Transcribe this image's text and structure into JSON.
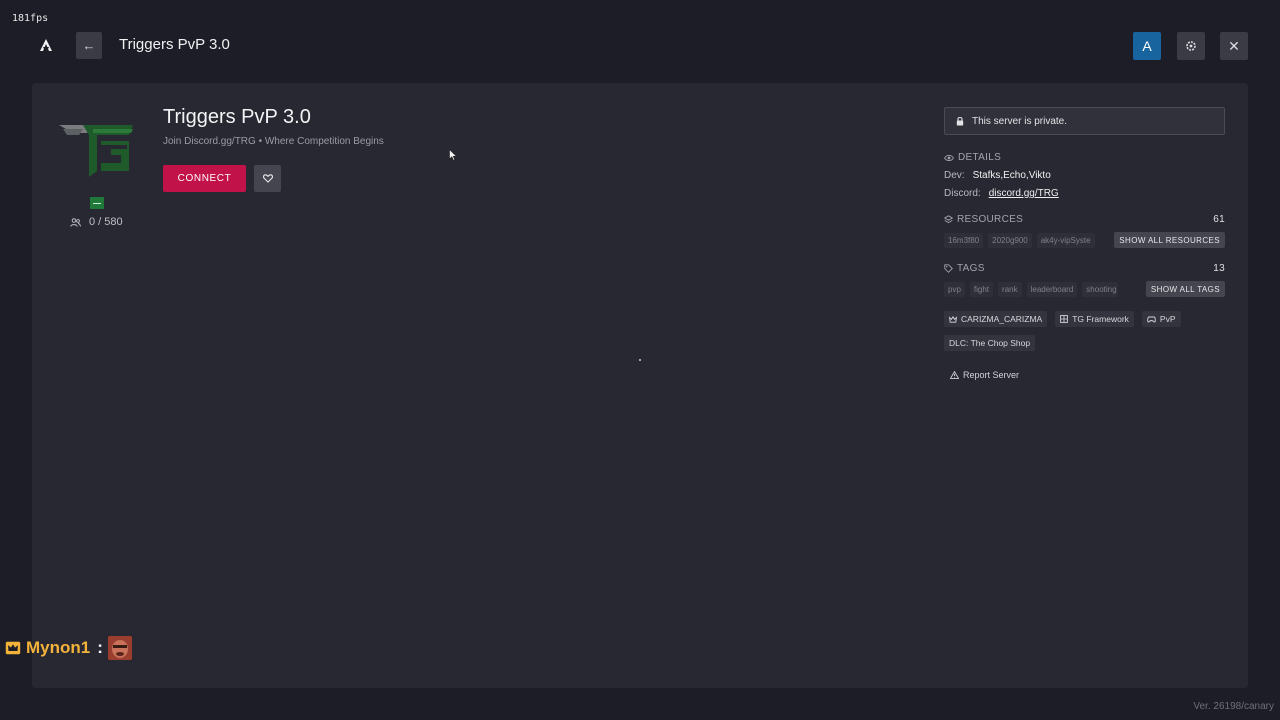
{
  "fps": "181fps",
  "header": {
    "title": "Triggers PvP 3.0",
    "account_initial": "A",
    "back_label": "←",
    "close_label": "✕"
  },
  "server": {
    "name": "Triggers PvP 3.0",
    "description": "Join Discord.gg/TRG • Where Competition Begins",
    "players": "0 / 580",
    "connect_label": "CONNECT"
  },
  "sidebar": {
    "private_notice": "This server is private.",
    "details": {
      "heading": "DETAILS",
      "dev_label": "Dev:",
      "dev_value": "Stafks,Echo,Vikto",
      "discord_label": "Discord:",
      "discord_value": "discord.gg/TRG"
    },
    "resources": {
      "heading": "RESOURCES",
      "count": "61",
      "items": [
        "16m3f80",
        "2020g900",
        "ak4y-vipSyste"
      ],
      "show_all_label": "SHOW ALL RESOURCES"
    },
    "tags": {
      "heading": "TAGS",
      "count": "13",
      "items": [
        "pvp",
        "fight",
        "rank",
        "leaderboard",
        "shooting"
      ],
      "show_all_label": "SHOW ALL TAGS"
    },
    "badges": [
      "CARIZMA_CARIZMA",
      "TG Framework",
      "PvP",
      "DLC: The Chop Shop"
    ],
    "report_label": "Report Server"
  },
  "chat": {
    "username": "Mynon1",
    "separator": ":"
  },
  "version": "Ver. 26198/canary",
  "colors": {
    "background": "#1c1d26",
    "panel": "#272831",
    "connect": "#c2124a",
    "account": "#17649e",
    "chat_name": "#f3b23a"
  }
}
